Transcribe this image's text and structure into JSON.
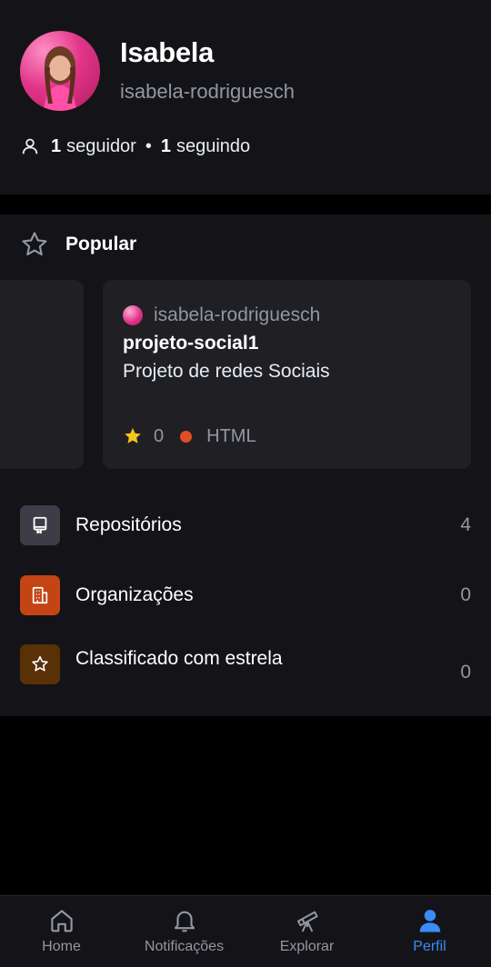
{
  "profile": {
    "name": "Isabela",
    "login": "isabela-rodriguesch",
    "followers_count": "1",
    "followers_label": "seguidor",
    "separator": "•",
    "following_count": "1",
    "following_label": "seguindo"
  },
  "popular": {
    "title": "Popular",
    "card": {
      "owner": "isabela-rodriguesch",
      "repo_name": "projeto-social1",
      "description": "Projeto de redes Sociais",
      "stars": "0",
      "language": "HTML",
      "language_color": "#e34c26"
    }
  },
  "menu": [
    {
      "label": "Repositórios",
      "count": "4",
      "icon": "repo-icon",
      "color": "#3d3d48"
    },
    {
      "label": "Organizações",
      "count": "0",
      "icon": "organization-icon",
      "color": "#c44414"
    },
    {
      "label": "Classificado com estrela",
      "count": "0",
      "icon": "star-icon",
      "color": "#5a3006"
    }
  ],
  "tabs": [
    {
      "label": "Home",
      "icon": "home-icon",
      "active": false
    },
    {
      "label": "Notificações",
      "icon": "bell-icon",
      "active": false
    },
    {
      "label": "Explorar",
      "icon": "telescope-icon",
      "active": false
    },
    {
      "label": "Perfil",
      "icon": "person-icon",
      "active": true
    }
  ],
  "colors": {
    "accent": "#3b8cf6",
    "background": "#000000",
    "surface": "#141418",
    "card": "#1f1f24"
  }
}
